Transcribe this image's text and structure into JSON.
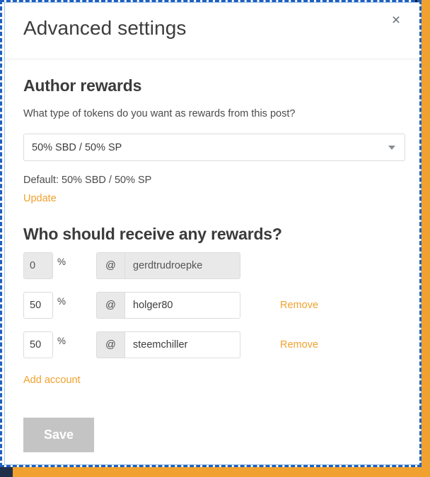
{
  "modal": {
    "title": "Advanced settings",
    "close_icon_label": "×"
  },
  "author_rewards": {
    "heading": "Author rewards",
    "question": "What type of tokens do you want as rewards from this post?",
    "selected_option": "50% SBD / 50% SP",
    "options": [
      "50% SBD / 50% SP"
    ],
    "default_note": "Default: 50% SBD / 50% SP",
    "update_label": "Update"
  },
  "beneficiaries": {
    "heading": "Who should receive any rewards?",
    "percent_sign": "%",
    "at_sign": "@",
    "rows": [
      {
        "percent": "0",
        "account": "gerdtrudroepke",
        "disabled": true,
        "remove_label": ""
      },
      {
        "percent": "50",
        "account": "holger80",
        "disabled": false,
        "remove_label": "Remove"
      },
      {
        "percent": "50",
        "account": "steemchiller",
        "disabled": false,
        "remove_label": "Remove"
      }
    ],
    "add_account_label": "Add account"
  },
  "footer": {
    "save_label": "Save"
  },
  "colors": {
    "accent_orange": "#f0a12f",
    "modal_border": "#9fc6e8",
    "selection_blue": "#1f5fbf",
    "disabled_gray": "#c4c4c4",
    "input_disabled_bg": "#e9e9e9",
    "text_dark": "#3b3b3b"
  }
}
